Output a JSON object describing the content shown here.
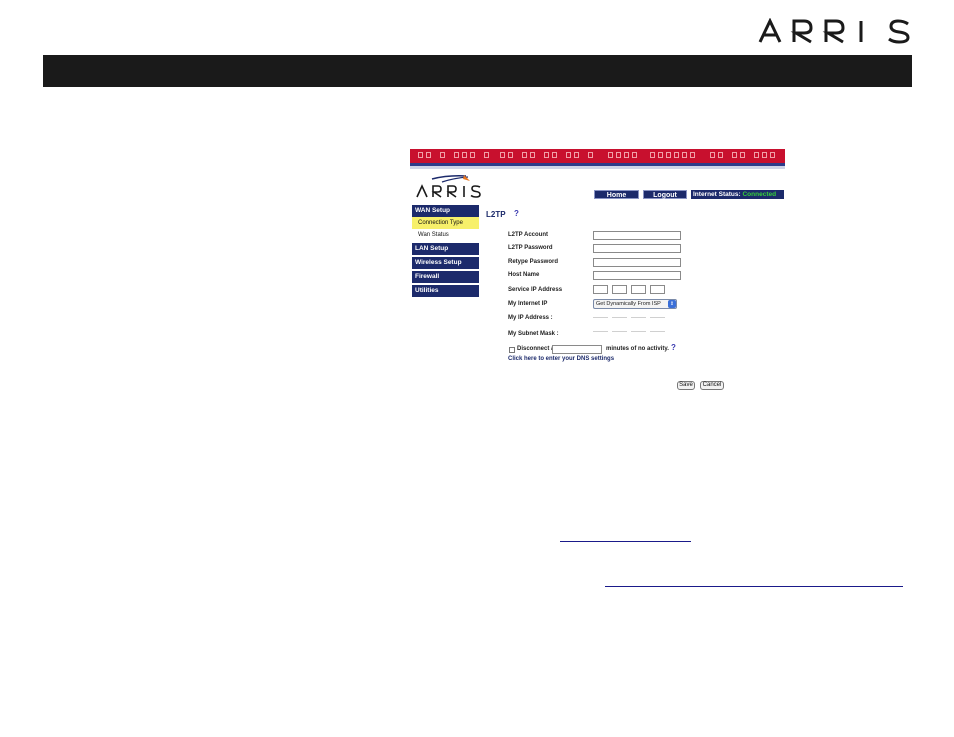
{
  "page": {
    "logo_text": "ARRIS"
  },
  "screenshot": {
    "logo_text": "ARRIS",
    "nav": {
      "home": "Home",
      "logout": "Logout"
    },
    "status": {
      "label": "Internet Status:",
      "value": "Connected",
      "value_color": "#36d13a"
    },
    "sidebar": [
      {
        "label": "WAN Setup",
        "type": "section"
      },
      {
        "label": "Connection Type",
        "type": "sub-active"
      },
      {
        "label": "Wan Status",
        "type": "sub"
      },
      {
        "label": "LAN Setup",
        "type": "section"
      },
      {
        "label": "Wireless Setup",
        "type": "section"
      },
      {
        "label": "Firewall",
        "type": "section"
      },
      {
        "label": "Utilities",
        "type": "section"
      }
    ],
    "section_title": "L2TP",
    "help_glyph": "?",
    "fields": {
      "l2tp_account": "L2TP Account",
      "l2tp_password": "L2TP Password",
      "retype_password": "Retype Password",
      "host_name": "Host Name",
      "service_ip": "Service IP Address",
      "my_internet_ip": "My Internet IP",
      "my_ip": "My IP Address :",
      "my_subnet": "My Subnet Mask :"
    },
    "internet_ip_select": "Get Dynamically From ISP",
    "disconnect": {
      "before": "Disconnect after",
      "after": "minutes of no activity."
    },
    "dns_link": "Click here to enter your DNS settings",
    "buttons": {
      "save": "Save",
      "cancel": "Cancel"
    },
    "colors": {
      "nav_blue": "#1c2a6b",
      "strip_red": "#c8102e",
      "highlight": "#f7f06a"
    }
  }
}
